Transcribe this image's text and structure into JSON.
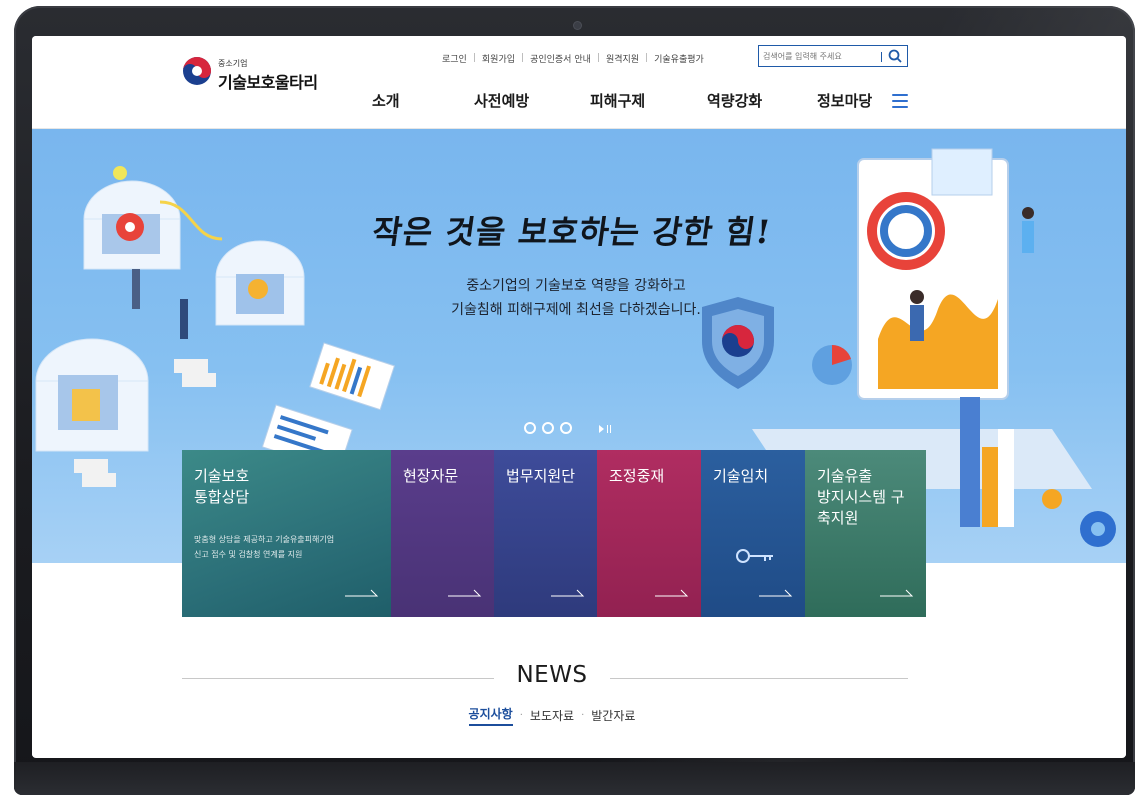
{
  "logo": {
    "sub": "중소기업",
    "title": "기술보호울타리"
  },
  "util_links": [
    "로그인",
    "회원가입",
    "공인인증서 안내",
    "원격지원",
    "기술유출평가"
  ],
  "search": {
    "placeholder": "검색어를 입력해 주세요"
  },
  "nav": [
    "소개",
    "사전예방",
    "피해구제",
    "역량강화",
    "정보마당"
  ],
  "hero": {
    "slogan": "작은 것을 보호하는 강한 힘!",
    "line1": "중소기업의 기술보호 역량을 강화하고",
    "line2": "기술침해 피해구제에 최선을 다하겠습니다."
  },
  "cards": [
    {
      "title": "기술보호\n통합상담",
      "desc": "맞춤형 상담을 제공하고 기술유출피해기업\n신고 접수 및 검찰청 연계를 지원",
      "color": "#2b6f78"
    },
    {
      "title": "현장자문",
      "color": "#493275"
    },
    {
      "title": "법무지원단",
      "color": "#2e3a7c"
    },
    {
      "title": "조정중재",
      "color": "#922151"
    },
    {
      "title": "기술임치",
      "color": "#1f4b86"
    },
    {
      "title": "기술유출\n방지시스템 구\n축지원",
      "color": "#2f6c5a"
    }
  ],
  "news": {
    "title": "NEWS",
    "tabs": [
      "공지사항",
      "보도자료",
      "발간자료"
    ],
    "active_tab": "공지사항"
  },
  "colors": {
    "accent": "#1f5aa8",
    "hero_bg": "#86c0f1"
  }
}
